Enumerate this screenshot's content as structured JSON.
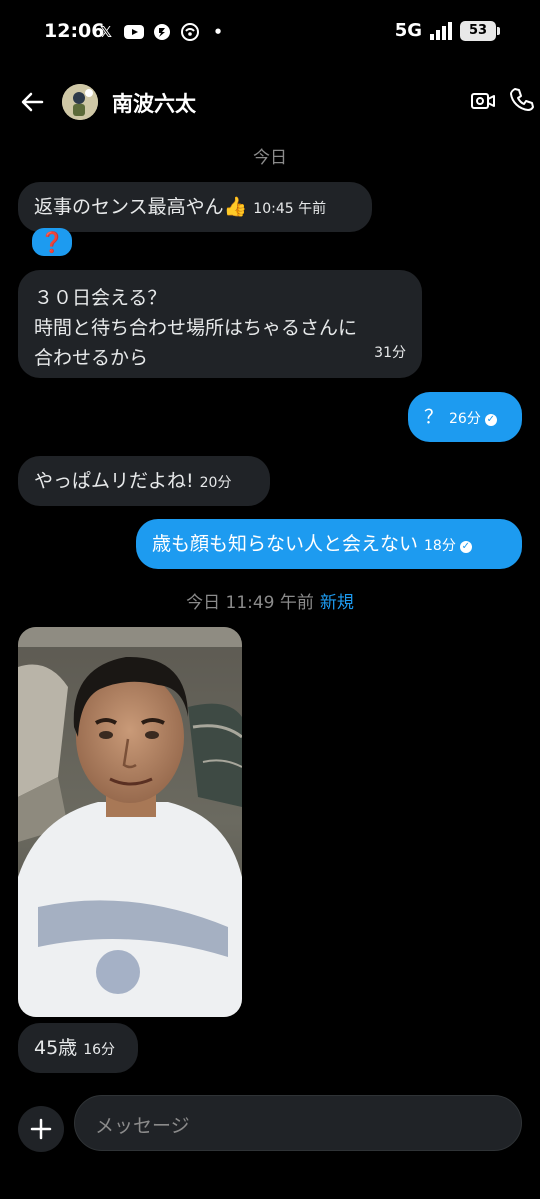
{
  "status_bar": {
    "time": "12:06",
    "network": "5G",
    "battery": "53",
    "notification_icons": [
      "x-icon",
      "youtube-icon",
      "app-icon",
      "hotspot-icon",
      "dot-icon"
    ]
  },
  "header": {
    "contact_name": "南波六太"
  },
  "date_today": "今日",
  "messages": [
    {
      "text": "返事のセンス最高やん👍",
      "time": "10:45 午前"
    },
    {
      "reaction": "❓"
    },
    {
      "lines": [
        "３０日会える？",
        "時間と待ち合わせ場所はちゃるさんに",
        "合わせるから"
      ],
      "time": "31分"
    },
    {
      "text": "？",
      "time": "26分"
    },
    {
      "text": "やっぱムリだよね!",
      "time": "20分"
    },
    {
      "text": "歳も顔も知らない人と会えない",
      "time": "18分"
    }
  ],
  "divider": {
    "label": "今日 11:49 午前",
    "badge": "新規"
  },
  "last_message": {
    "text": "45歳",
    "time": "16分"
  },
  "composer": {
    "placeholder": "メッセージ"
  },
  "colors": {
    "accent": "#1d9bf0",
    "incoming_bubble": "#202327",
    "background": "#000000"
  }
}
